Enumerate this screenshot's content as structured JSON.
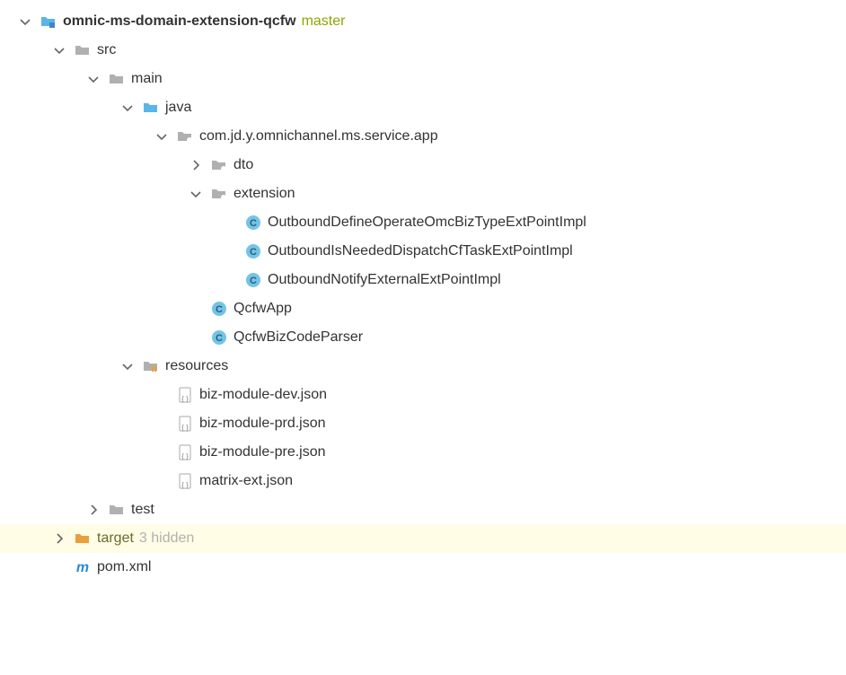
{
  "tree": {
    "root": {
      "name": "omnic-ms-domain-extension-qcfw",
      "branch": "master"
    },
    "src": "src",
    "main": "main",
    "java": "java",
    "pkg": "com.jd.y.omnichannel.ms.service.app",
    "dto": "dto",
    "extension": "extension",
    "ext_classes": {
      "c0": "OutboundDefineOperateOmcBizTypeExtPointImpl",
      "c1": "OutboundIsNeededDispatchCfTaskExtPointImpl",
      "c2": "OutboundNotifyExternalExtPointImpl"
    },
    "app_classes": {
      "c0": "QcfwApp",
      "c1": "QcfwBizCodeParser"
    },
    "resources": "resources",
    "res_files": {
      "f0": "biz-module-dev.json",
      "f1": "biz-module-prd.json",
      "f2": "biz-module-pre.json",
      "f3": "matrix-ext.json"
    },
    "test": "test",
    "target": "target",
    "target_hint": "3 hidden",
    "pom": "pom.xml"
  }
}
